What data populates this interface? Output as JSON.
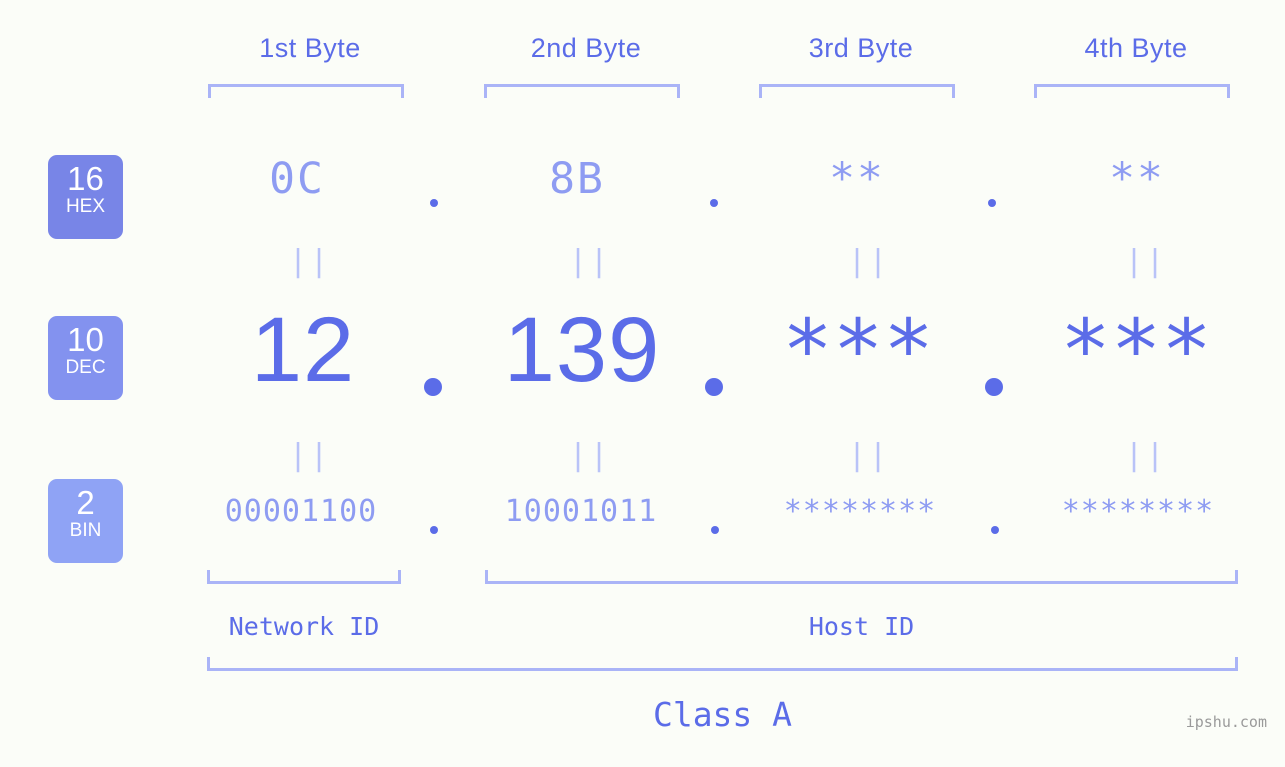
{
  "meta": {
    "background_color": "#fbfdf8",
    "accent_color": "#5b6ce8",
    "muted_color": "#8e9cf2",
    "bracket_color": "#aab4f7",
    "watermark": "ipshu.com"
  },
  "header": {
    "byte_labels": [
      {
        "label": "1st Byte"
      },
      {
        "label": "2nd Byte"
      },
      {
        "label": "3rd Byte"
      },
      {
        "label": "4th Byte"
      }
    ]
  },
  "bases": [
    {
      "num": "16",
      "name": "HEX",
      "color": "#7885e7"
    },
    {
      "num": "10",
      "name": "DEC",
      "color": "#8392ef"
    },
    {
      "num": "2",
      "name": "BIN",
      "color": "#8fa3f5"
    }
  ],
  "rows": {
    "hex": {
      "values": [
        "0C",
        "8B",
        "**",
        "**"
      ],
      "separator": "."
    },
    "dec": {
      "values": [
        "12",
        "139",
        "***",
        "***"
      ],
      "separator": "."
    },
    "bin": {
      "values": [
        "00001100",
        "10001011",
        "********",
        "********"
      ],
      "separator": "."
    }
  },
  "equality_marks": {
    "glyph": "||",
    "count_per_row": 4
  },
  "segments": [
    {
      "name": "Network ID",
      "label": "Network ID"
    },
    {
      "name": "Host ID",
      "label": "Host ID"
    }
  ],
  "class": {
    "label": "Class A"
  }
}
